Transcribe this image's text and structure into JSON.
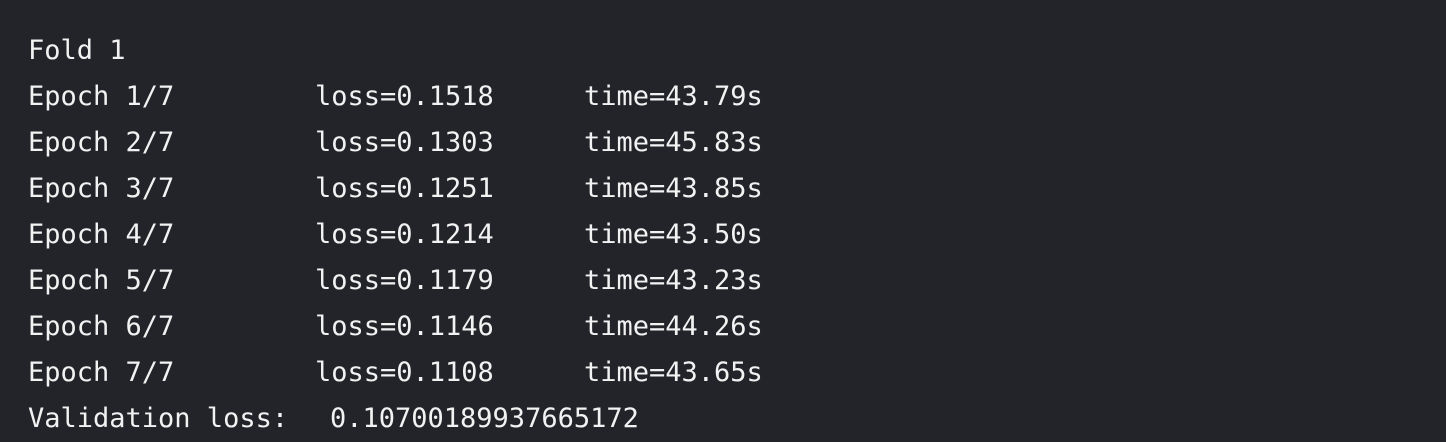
{
  "output": {
    "fold_header": "Fold 1",
    "epochs": [
      {
        "epoch": "Epoch 1/7",
        "loss": "loss=0.1518",
        "time": "time=43.79s"
      },
      {
        "epoch": "Epoch 2/7",
        "loss": "loss=0.1303",
        "time": "time=45.83s"
      },
      {
        "epoch": "Epoch 3/7",
        "loss": "loss=0.1251",
        "time": "time=43.85s"
      },
      {
        "epoch": "Epoch 4/7",
        "loss": "loss=0.1214",
        "time": "time=43.50s"
      },
      {
        "epoch": "Epoch 5/7",
        "loss": "loss=0.1179",
        "time": "time=43.23s"
      },
      {
        "epoch": "Epoch 6/7",
        "loss": "loss=0.1146",
        "time": "time=44.26s"
      },
      {
        "epoch": "Epoch 7/7",
        "loss": "loss=0.1108",
        "time": "time=43.65s"
      }
    ],
    "validation_label": "Validation loss:",
    "validation_value": "0.10700189937665172"
  },
  "colors": {
    "background": "#23242a",
    "text": "#f2f2f2"
  }
}
